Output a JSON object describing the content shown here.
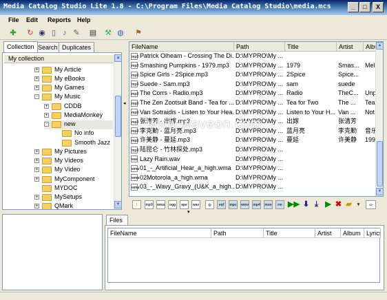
{
  "window": {
    "title": "Media Catalog Studio Lite 1.8 - C:\\Program Files\\Media Catalog Studio\\media.mcs",
    "minimize": "_",
    "maximize": "□",
    "close": "X"
  },
  "menu": [
    {
      "label": "File"
    },
    {
      "label": "Edit"
    },
    {
      "label": "Reports"
    },
    {
      "label": "Help"
    }
  ],
  "left_tabs": [
    "Collection",
    "Search",
    "Duplicates"
  ],
  "tree": {
    "root": "My collection",
    "items": [
      {
        "label": "My Article",
        "expander": "+"
      },
      {
        "label": "My eBooks",
        "expander": "+"
      },
      {
        "label": "My Games",
        "expander": "+"
      },
      {
        "label": "My Music",
        "expander": "-"
      },
      {
        "label": "CDDB",
        "expander": "+"
      },
      {
        "label": "MediaMonkey",
        "expander": "+"
      },
      {
        "label": "new",
        "expander": "-"
      },
      {
        "label": "No info",
        "expander": ""
      },
      {
        "label": "Smooth Jazz",
        "expander": ""
      },
      {
        "label": "My Pictures",
        "expander": "+"
      },
      {
        "label": "My Videos",
        "expander": "+"
      },
      {
        "label": "My Video",
        "expander": "+"
      },
      {
        "label": "MyComponent",
        "expander": "+"
      },
      {
        "label": "MYDOC",
        "expander": ""
      },
      {
        "label": "MySetups",
        "expander": "+"
      },
      {
        "label": "QMark",
        "expander": "+"
      }
    ]
  },
  "file_columns": [
    "FileName",
    "Path",
    "Title",
    "Artist",
    "Album"
  ],
  "files": [
    {
      "icon": "mp3",
      "name": "Patrick Olheam - Crossing The Di...",
      "path": "D:\\MYPRO\\My ...",
      "title": "",
      "artist": "",
      "album": ""
    },
    {
      "icon": "mp3",
      "name": "Smashing Pumpkins - 1979.mp3",
      "path": "D:\\MYPRO\\My ...",
      "title": "1979",
      "artist": "Smas...",
      "album": "Mel"
    },
    {
      "icon": "mp3",
      "name": "Spice Girls - 2Spice.mp3",
      "path": "D:\\MYPRO\\My ...",
      "title": "2Spice",
      "artist": "Spice...",
      "album": ""
    },
    {
      "icon": "mp3",
      "name": "Suede - Sam.mp3",
      "path": "D:\\MYPRO\\My ...",
      "title": "sam",
      "artist": "suede",
      "album": ""
    },
    {
      "icon": "mp3",
      "name": "The Corrs - Radio.mp3",
      "path": "D:\\MYPRO\\My ...",
      "title": "Radio",
      "artist": "TheC...",
      "album": "Unp"
    },
    {
      "icon": "mp3",
      "name": "The Zen Zootsuit Band - Tea for ...",
      "path": "D:\\MYPRO\\My ...",
      "title": "Tea for Two",
      "artist": "The ...",
      "album": "Tea"
    },
    {
      "icon": "mp3",
      "name": "Van Sotraidis - Listen to Your Hea...",
      "path": "D:\\MYPRO\\My ...",
      "title": "Listen to Your H...",
      "artist": "Van ...",
      "album": "Not"
    },
    {
      "icon": "mp3",
      "name": "张清芳 - 出嫁.mp3",
      "path": "D:\\MYPRO\\My ...",
      "title": "出嫁",
      "artist": "张清芳",
      "album": ""
    },
    {
      "icon": "mp3",
      "name": "李克勤 - 蓝月亮.mp3",
      "path": "D:\\MYPRO\\My ...",
      "title": "蓝月亮",
      "artist": "李克勤",
      "album": "音乐"
    },
    {
      "icon": "mp3",
      "name": "许美静 - 蔓延.mp3",
      "path": "D:\\MYPRO\\My ...",
      "title": "蔓延",
      "artist": "许美静",
      "album": "199"
    },
    {
      "icon": "mp3",
      "name": "陆昆仑 - 竹林探处.mp3",
      "path": "D:\\MYPRO\\My ...",
      "title": "",
      "artist": "",
      "album": ""
    },
    {
      "icon": "wav",
      "name": "Lazy Rain.wav",
      "path": "D:\\MYPRO\\My ...",
      "title": "",
      "artist": "",
      "album": ""
    },
    {
      "icon": "wma",
      "name": "01_-_Artificial_Hear_a_high.wma",
      "path": "D:\\MYPRO\\My ...",
      "title": "",
      "artist": "",
      "album": ""
    },
    {
      "icon": "wma",
      "name": "02Motorola_a_high.wma",
      "path": "D:\\MYPRO\\My ...",
      "title": "",
      "artist": "",
      "album": ""
    },
    {
      "icon": "wma",
      "name": "03_-_Wavy_Gravy_(U&K_a_high...",
      "path": "D:\\MYPRO\\My ...",
      "title": "",
      "artist": "",
      "album": ""
    }
  ],
  "bottom_toolbar": [
    "mp3",
    "wma",
    "ogg",
    "ape",
    "wav",
    "",
    "vqf",
    "mpc",
    "wmv",
    "mp4",
    "mov",
    "rm",
    "play",
    "down",
    "down2",
    "play2",
    "delete",
    "folder",
    "options",
    "view"
  ],
  "files_tab": "Files",
  "files_columns": [
    "FileName",
    "Path",
    "Title",
    "Artist",
    "Album",
    "Lyrics"
  ],
  "watermark": "www.waveon.com"
}
